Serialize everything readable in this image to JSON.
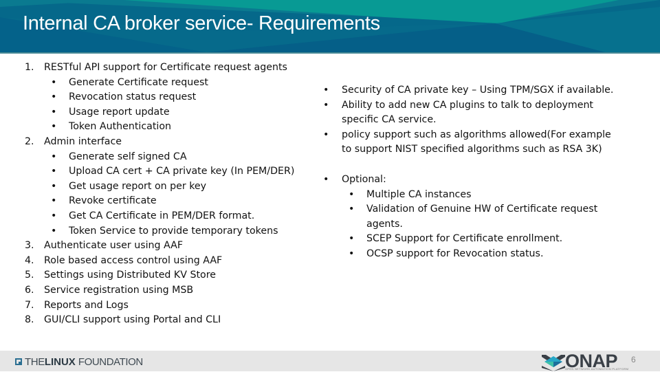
{
  "header": {
    "title": "Internal CA broker service-  Requirements",
    "colors": {
      "band_dark": "#05688a",
      "band_teal": "#089a94",
      "band_mid": "#0a7a90"
    }
  },
  "left_list": [
    {
      "number": "1.",
      "text": "RESTful API support for Certificate request agents",
      "subitems": [
        "Generate Certificate request",
        "Revocation status request",
        "Usage report update",
        "Token Authentication"
      ]
    },
    {
      "number": "2.",
      "text": "Admin interface",
      "subitems": [
        "Generate self signed CA",
        "Upload CA cert + CA private key (In PEM/DER)",
        "Get usage report on per key",
        "Revoke certificate",
        "Get CA Certificate in PEM/DER format.",
        "Token Service to provide temporary tokens"
      ]
    },
    {
      "number": "3.",
      "text": "Authenticate user using AAF",
      "subitems": []
    },
    {
      "number": "4.",
      "text": "Role based access control using AAF",
      "subitems": []
    },
    {
      "number": "5.",
      "text": "Settings using Distributed KV Store",
      "subitems": []
    },
    {
      "number": "6.",
      "text": "Service registration using MSB",
      "subitems": []
    },
    {
      "number": "7.",
      "text": "Reports and Logs",
      "subitems": []
    },
    {
      "number": "8.",
      "text": "GUI/CLI support using Portal and CLI",
      "subitems": []
    }
  ],
  "right_list": {
    "bullets": [
      {
        "lines": [
          "Security of CA private key – Using TPM/SGX if available."
        ]
      },
      {
        "lines": [
          "Ability to add new CA plugins to talk to deployment",
          "specific CA service."
        ]
      },
      {
        "lines": [
          "policy support such as algorithms allowed(For example",
          "to support NIST specified algorithms such as RSA 3K)"
        ]
      }
    ],
    "optional": {
      "label": "Optional:",
      "subitems": [
        {
          "lines": [
            "Multiple CA instances"
          ]
        },
        {
          "lines": [
            "Validation of Genuine HW of Certificate request",
            "agents."
          ]
        },
        {
          "lines": [
            "SCEP Support for Certificate enrollment."
          ]
        },
        {
          "lines": [
            "OCSP support for Revocation status."
          ]
        }
      ]
    },
    "bullet_char": "•"
  },
  "footer": {
    "linux_foundation": {
      "the": "THE",
      "linux": "LINUX",
      "foundation": "FOUNDATION"
    },
    "onap": {
      "word": "ONAP",
      "tagline": "OPEN NETWORK AUTOMATION PLATFORM"
    },
    "page_number": "6"
  }
}
